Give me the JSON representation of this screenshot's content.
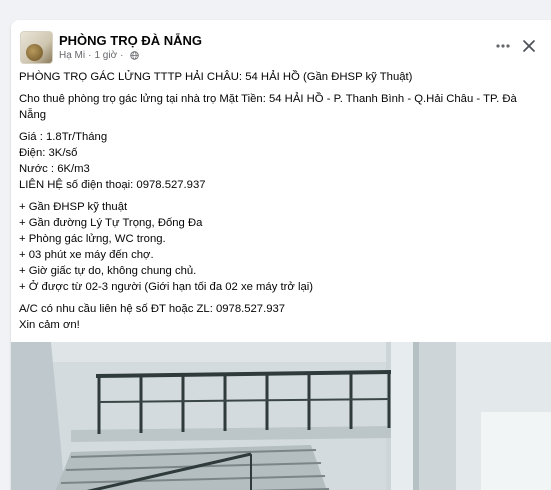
{
  "post": {
    "page_name": "PHÒNG TRỌ ĐÀ NẴNG",
    "meta": {
      "author": "Hạ Mi",
      "separator": "·",
      "time": "1 giờ",
      "privacy_icon": "globe-icon"
    },
    "actions": {
      "more_icon": "more-horizontal-icon",
      "close_icon": "close-icon"
    },
    "lines": {
      "title": "PHÒNG TRỌ GÁC LỬNG TTTP HẢI CHÂU: 54 HẢI HỒ (Gần ĐHSP kỹ Thuật)",
      "intro_1": "Cho thuê phòng trọ gác lửng tại nhà trọ Mặt Tiền: 54 HẢI HỒ - P. Thanh Bình - Q.Hải Châu - TP. Đà",
      "intro_2": "Nẵng",
      "price": "Giá : 1.8Tr/Tháng",
      "electric": "Điện: 3K/số",
      "water": "Nước : 6K/m3",
      "contact": "LIÊN HỆ số điện thoại: 0978.527.937",
      "feat_1": "+ Gần ĐHSP kỹ thuật",
      "feat_2": "+ Gần đường Lý Tự Trọng, Đống Đa",
      "feat_3": "+ Phòng gác lửng, WC trong.",
      "feat_4": "+ 03 phút xe máy đến chợ.",
      "feat_5": "+ Giờ giấc tự do, không chung chủ.",
      "feat_6": "+ Ở được từ 02-3 người (Giới hạn tối đa 02 xe máy trở lại)",
      "closing_1": "A/C có nhu cầu liên hệ số ĐT hoặc ZL: 0978.527.937",
      "closing_2": "Xin cảm ơn!"
    },
    "photo_subject": "mezzanine-room-photo"
  },
  "colors": {
    "background": "#f0f2f5",
    "card": "#ffffff",
    "text": "#050505",
    "secondary_text": "#65676b",
    "railing": "#2f3a3a",
    "wall": "#cfd6d9"
  }
}
